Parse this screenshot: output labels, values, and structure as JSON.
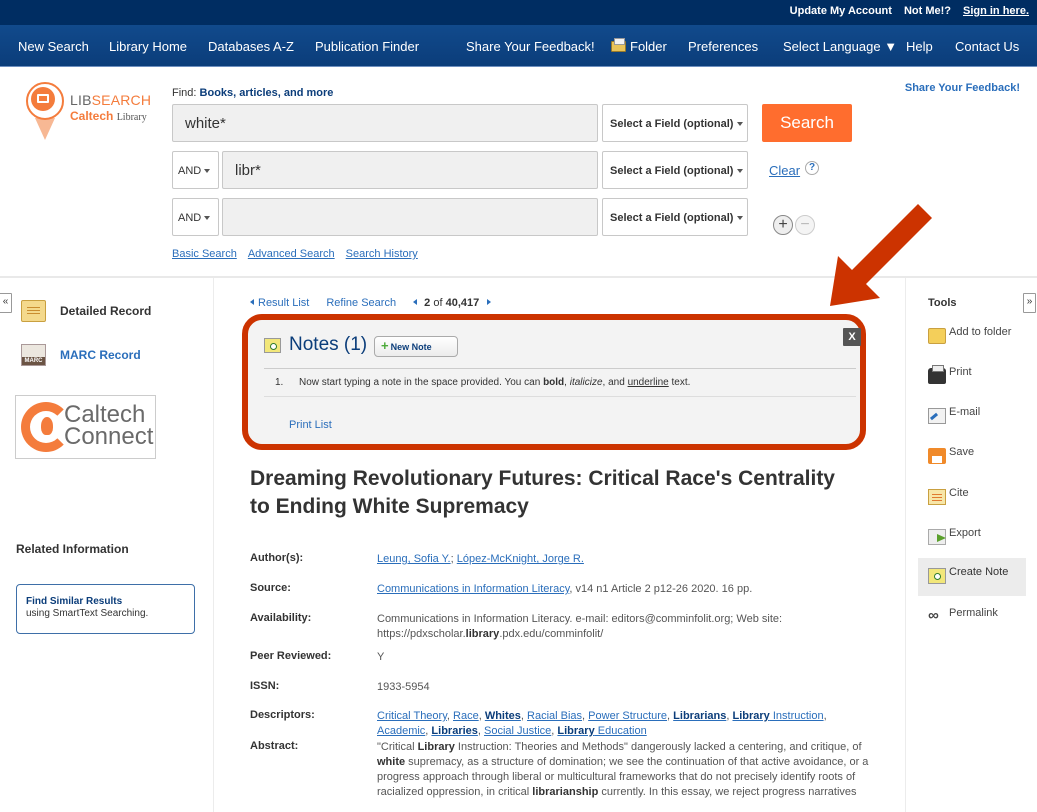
{
  "topbar": {
    "update_account": "Update My Account",
    "not_me": "Not Me!?",
    "sign_in": "Sign in here."
  },
  "nav": {
    "items": [
      "New Search",
      "Library Home",
      "Databases A-Z",
      "Publication Finder",
      "Share Your Feedback!",
      "Folder",
      "Preferences",
      "Select Language ▼",
      "Help",
      "Contact Us"
    ]
  },
  "logo": {
    "brand_a": "LIB",
    "brand_b": "SEARCH",
    "sub_a": "Caltech",
    "sub_b": "Library"
  },
  "search": {
    "find_prefix": "Find:",
    "find_label": "Books, articles, and more",
    "rows": [
      {
        "bool": "",
        "value": "white*",
        "field": "Select a Field (optional)"
      },
      {
        "bool": "AND",
        "value": "libr*",
        "field": "Select a Field (optional)"
      },
      {
        "bool": "AND",
        "value": "",
        "field": "Select a Field (optional)"
      }
    ],
    "search_button": "Search",
    "clear_link": "Clear",
    "help_icon": "?",
    "plus_icon": "+",
    "minus_icon": "−",
    "links": [
      "Basic Search",
      "Advanced Search",
      "Search History"
    ],
    "share_feedback": "Share Your Feedback!"
  },
  "left": {
    "collapse": "«",
    "detailed_record": "Detailed Record",
    "marc_record": "MARC Record",
    "caltech_connect_a": "Caltech",
    "caltech_connect_b": "Connect",
    "related_info": "Related Information",
    "find_similar_title": "Find Similar Results",
    "find_similar_sub": "using SmartText Searching."
  },
  "result_nav": {
    "result_list": "Result List",
    "refine_search": "Refine Search",
    "current": "2",
    "of": "of",
    "total": "40,417"
  },
  "notes": {
    "title": "Notes (1)",
    "new_note": "New Note",
    "close": "X",
    "items": [
      {
        "num": "1.",
        "text_a": "Now start typing a note in the space provided. You can ",
        "bold": "bold",
        "text_b": ", ",
        "italic": "italicize",
        "text_c": ", and ",
        "underline": "underline",
        "text_d": " text."
      }
    ],
    "print_list": "Print List"
  },
  "record": {
    "title": "Dreaming Revolutionary Futures: Critical Race's Centrality to Ending White Supremacy",
    "labels": {
      "authors": "Author(s):",
      "source": "Source:",
      "availability": "Availability:",
      "peer_reviewed": "Peer Reviewed:",
      "issn": "ISSN:",
      "descriptors": "Descriptors:",
      "abstract": "Abstract:"
    },
    "authors": [
      "Leung, Sofia Y.",
      "López-McKnight, Jorge R."
    ],
    "source_link": "Communications in Information Literacy",
    "source_rest": ", v14 n1 Article 2 p12-26 2020. 16 pp.",
    "availability_a": "Communications in Information Literacy. e-mail: editors@comminfolit.org; Web site: https://pdxscholar.",
    "availability_bold": "library",
    "availability_b": ".pdx.edu/comminfolit/",
    "peer_reviewed": "Y",
    "issn": "1933-5954",
    "descriptors": [
      {
        "text": "Critical Theory",
        "bold": false
      },
      {
        "text": "Race",
        "bold": false
      },
      {
        "text": "Whites",
        "bold": true
      },
      {
        "text": "Racial Bias",
        "bold": false
      },
      {
        "text": "Power Structure",
        "bold": false
      },
      {
        "text": "Librarians",
        "bold": true
      },
      {
        "text": "Library",
        "bold": true,
        "suffix": " Instruction"
      },
      {
        "text": "Academic",
        "bold": false
      },
      {
        "text": "Libraries",
        "bold": true
      },
      {
        "text": "Social Justice",
        "bold": false
      },
      {
        "text": "Library",
        "bold": true,
        "suffix": " Education"
      }
    ],
    "abstract": [
      {
        "t": "\"Critical "
      },
      {
        "b": "Library"
      },
      {
        "t": " Instruction: Theories and Methods\" dangerously lacked a centering, and critique, of "
      },
      {
        "b": "white"
      },
      {
        "t": " supremacy, as a structure of domination; we see the continuation of that active avoidance, or a progress approach through liberal or multicultural frameworks that do not precisely identify roots of racialized oppression, in critical "
      },
      {
        "b": "librarianship"
      },
      {
        "t": " currently. In this essay, we reject progress narratives"
      }
    ]
  },
  "tools": {
    "heading": "Tools",
    "expand": "»",
    "items": [
      "Add to folder",
      "Print",
      "E-mail",
      "Save",
      "Cite",
      "Export",
      "Create Note",
      "Permalink"
    ]
  },
  "annotation": {
    "color": "#cc3300"
  }
}
